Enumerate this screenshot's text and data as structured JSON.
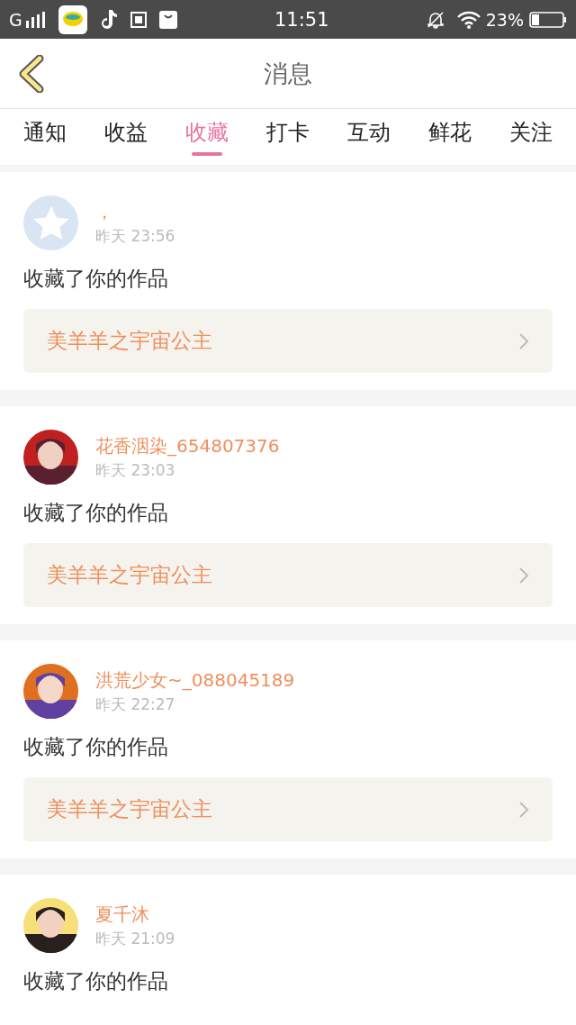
{
  "status_bar": {
    "network": "G",
    "time": "11:51",
    "battery": "23%"
  },
  "header": {
    "title": "消息"
  },
  "tabs": [
    {
      "label": "通知",
      "selected": false
    },
    {
      "label": "收益",
      "selected": false
    },
    {
      "label": "收藏",
      "selected": true
    },
    {
      "label": "打卡",
      "selected": false
    },
    {
      "label": "互动",
      "selected": false
    },
    {
      "label": "鲜花",
      "selected": false
    },
    {
      "label": "关注",
      "selected": false
    }
  ],
  "messages": [
    {
      "avatar": {
        "kind": "default"
      },
      "name": "，",
      "time": "昨天 23:56",
      "text": "收藏了你的作品",
      "work": "美羊羊之宇宙公主"
    },
    {
      "name": "花香洇染_654807376",
      "time": "昨天 23:03",
      "text": "收藏了你的作品",
      "work": "美羊羊之宇宙公主"
    },
    {
      "name": "洪荒少女~_088045189",
      "time": "昨天 22:27",
      "text": "收藏了你的作品",
      "work": "美羊羊之宇宙公主"
    },
    {
      "name": "夏千沐",
      "time": "昨天 21:09",
      "text": "收藏了你的作品"
    }
  ]
}
